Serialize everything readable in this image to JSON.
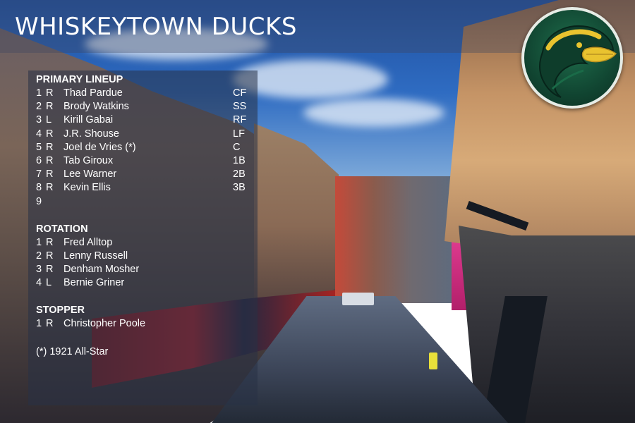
{
  "team_name": "WHISKEYTOWN DUCKS",
  "sections": {
    "lineup": {
      "heading": "PRIMARY LINEUP",
      "rows": [
        {
          "num": "1",
          "hand": "R",
          "name": "Thad Pardue",
          "pos": "CF"
        },
        {
          "num": "2",
          "hand": "R",
          "name": "Brody Watkins",
          "pos": "SS"
        },
        {
          "num": "3",
          "hand": "L",
          "name": "Kirill Gabai",
          "pos": "RF"
        },
        {
          "num": "4",
          "hand": "R",
          "name": "J.R. Shouse",
          "pos": "LF"
        },
        {
          "num": "5",
          "hand": "R",
          "name": "Joel de Vries (*)",
          "pos": "C"
        },
        {
          "num": "6",
          "hand": "R",
          "name": "Tab Giroux",
          "pos": "1B"
        },
        {
          "num": "7",
          "hand": "R",
          "name": "Lee Warner",
          "pos": "2B"
        },
        {
          "num": "8",
          "hand": "R",
          "name": "Kevin Ellis",
          "pos": "3B"
        },
        {
          "num": "9",
          "hand": "",
          "name": "",
          "pos": ""
        }
      ]
    },
    "rotation": {
      "heading": "ROTATION",
      "rows": [
        {
          "num": "1",
          "hand": "R",
          "name": "Fred Alltop"
        },
        {
          "num": "2",
          "hand": "R",
          "name": "Lenny Russell"
        },
        {
          "num": "3",
          "hand": "R",
          "name": "Denham Mosher"
        },
        {
          "num": "4",
          "hand": "L",
          "name": "Bernie Griner"
        }
      ]
    },
    "stopper": {
      "heading": "STOPPER",
      "rows": [
        {
          "num": "1",
          "hand": "R",
          "name": "Christopher Poole"
        }
      ]
    }
  },
  "footnote": "(*) 1921 All-Star",
  "colors": {
    "logo_green": "#114632",
    "logo_gold": "#e9c32f",
    "text": "#ffffff"
  },
  "logo": {
    "icon": "duck-head-icon"
  }
}
